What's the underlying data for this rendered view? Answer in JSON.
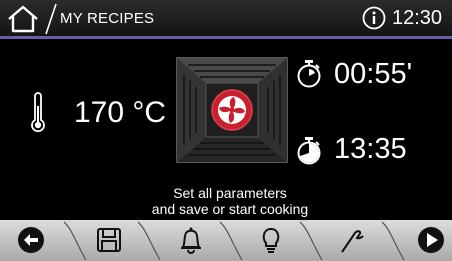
{
  "header": {
    "title": "MY RECIPES",
    "time": "12:30"
  },
  "main": {
    "temperature": "170 °C",
    "duration": "00:55'",
    "end_time": "13:35",
    "message_line1": "Set all parameters",
    "message_line2": "and save or start cooking"
  },
  "colors": {
    "accent": "#6f5ba8",
    "fan": "#c8202f"
  },
  "footer": {
    "icons": [
      "back-arrow-icon",
      "save-disk-icon",
      "bell-icon",
      "light-bulb-icon",
      "probe-icon",
      "play-icon"
    ]
  }
}
